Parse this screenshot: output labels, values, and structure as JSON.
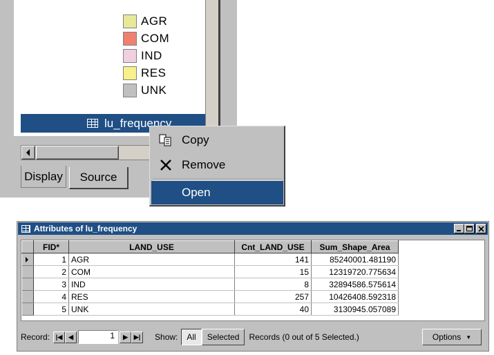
{
  "toc": {
    "legend": [
      {
        "label": "AGR",
        "color": "#e8e89a"
      },
      {
        "label": "COM",
        "color": "#f08070"
      },
      {
        "label": "IND",
        "color": "#f0d0e0"
      },
      {
        "label": "RES",
        "color": "#f8f08a"
      },
      {
        "label": "UNK",
        "color": "#c0c0c0"
      }
    ],
    "table_item": "lu_frequency",
    "tabs": {
      "display": "Display",
      "source": "Source"
    }
  },
  "context_menu": {
    "copy": "Copy",
    "remove": "Remove",
    "open": "Open"
  },
  "attributes": {
    "title": "Attributes of lu_frequency",
    "columns": [
      "FID*",
      "LAND_USE",
      "Cnt_LAND_USE",
      "Sum_Shape_Area"
    ],
    "rows": [
      {
        "fid": "1",
        "land_use": "AGR",
        "count": "141",
        "area": "85240001.481190"
      },
      {
        "fid": "2",
        "land_use": "COM",
        "count": "15",
        "area": "12319720.775634"
      },
      {
        "fid": "3",
        "land_use": "IND",
        "count": "8",
        "area": "32894586.575614"
      },
      {
        "fid": "4",
        "land_use": "RES",
        "count": "257",
        "area": "10426408.592318"
      },
      {
        "fid": "5",
        "land_use": "UNK",
        "count": "40",
        "area": "3130945.057089"
      }
    ],
    "record_label": "Record:",
    "record_value": "1",
    "show_label": "Show:",
    "all_label": "All",
    "selected_label": "Selected",
    "records_status": "Records (0 out of 5 Selected.)",
    "options_label": "Options"
  },
  "colors": {
    "highlight": "#1f4f84",
    "chrome": "#c0c0c0"
  }
}
